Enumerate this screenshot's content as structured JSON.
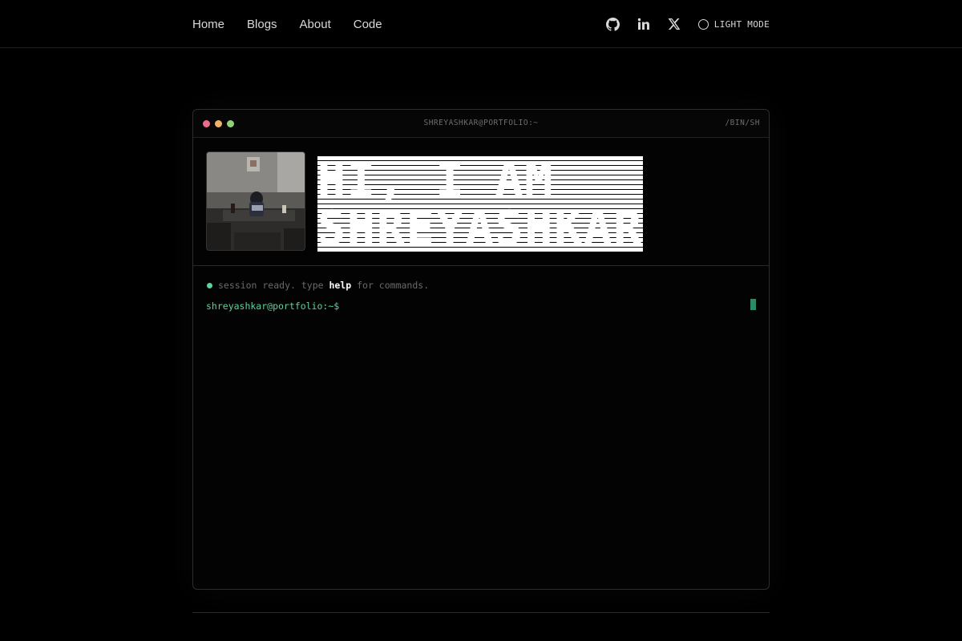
{
  "nav": {
    "items": [
      "Home",
      "Blogs",
      "About",
      "Code"
    ]
  },
  "social": {
    "github": "github-icon",
    "linkedin": "linkedin-icon",
    "x": "x-icon"
  },
  "theme_toggle": {
    "label": "LIGHT MODE"
  },
  "terminal": {
    "title": "SHREYASHKAR@PORTFOLIO:~",
    "shell": "/BIN/SH",
    "dot_colors": [
      "#ef6b8a",
      "#eeb36a",
      "#8fd27a"
    ],
    "headline_line1": "HI, I AM",
    "headline_line2": "SHREYASHKAR",
    "status_prefix": "session ready. type ",
    "status_keyword": "help",
    "status_suffix": " for commands.",
    "prompt": "shreyashkar@portfolio:~$"
  },
  "colors": {
    "accent": "#5fd39b",
    "background": "#000000"
  }
}
